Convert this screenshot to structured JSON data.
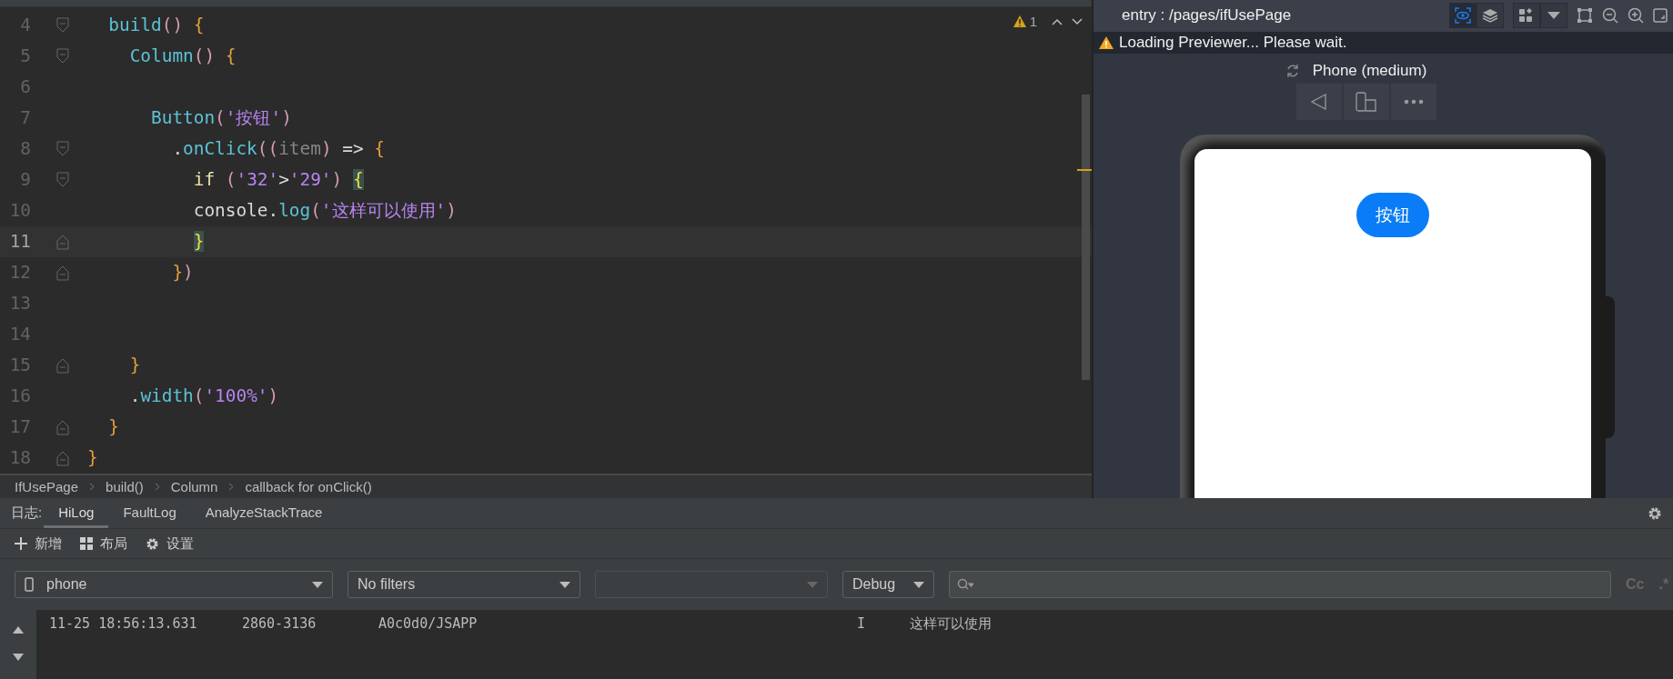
{
  "editor": {
    "warning_count": "1",
    "lines": [
      {
        "number": "4",
        "current": false,
        "block_start": true,
        "tokens": [
          {
            "kind": "fn",
            "text": "  build"
          },
          {
            "kind": "paren",
            "text": "()"
          },
          {
            "kind": "brace",
            "text": " {"
          }
        ]
      },
      {
        "number": "5",
        "current": false,
        "block_start": true,
        "tokens": [
          {
            "kind": "fn",
            "text": "    Column"
          },
          {
            "kind": "paren",
            "text": "()"
          },
          {
            "kind": "brace",
            "text": " {"
          }
        ]
      },
      {
        "number": "6",
        "current": false
      },
      {
        "number": "7",
        "current": false,
        "tokens": [
          {
            "kind": "fn",
            "text": "      Button"
          },
          {
            "kind": "paren",
            "text": "("
          },
          {
            "kind": "string",
            "text": "'按钮'"
          },
          {
            "kind": "paren",
            "text": ")"
          }
        ]
      },
      {
        "number": "8",
        "current": false,
        "block_start": true,
        "tokens": [
          {
            "kind": "plain",
            "text": "        ."
          },
          {
            "kind": "fn",
            "text": "onClick"
          },
          {
            "kind": "paren",
            "text": "(("
          },
          {
            "kind": "param",
            "text": "item"
          },
          {
            "kind": "paren",
            "text": ")"
          },
          {
            "kind": "plain",
            "text": " => "
          },
          {
            "kind": "brace",
            "text": "{"
          }
        ]
      },
      {
        "number": "9",
        "current": false,
        "block_start": true,
        "tokens": [
          {
            "kind": "kw",
            "text": "          if "
          },
          {
            "kind": "paren",
            "text": "("
          },
          {
            "kind": "string",
            "text": "'32'"
          },
          {
            "kind": "plain",
            "text": ">"
          },
          {
            "kind": "string",
            "text": "'29'"
          },
          {
            "kind": "paren",
            "text": ") "
          },
          {
            "kind": "match",
            "text": "{"
          }
        ]
      },
      {
        "number": "10",
        "current": false,
        "tokens": [
          {
            "kind": "plain",
            "text": "          console."
          },
          {
            "kind": "fn",
            "text": "log"
          },
          {
            "kind": "paren",
            "text": "("
          },
          {
            "kind": "string",
            "text": "'这样可以使用'"
          },
          {
            "kind": "paren",
            "text": ")"
          }
        ]
      },
      {
        "number": "11",
        "current": true,
        "block_end": true,
        "tokens": [
          {
            "kind": "match",
            "text": "          }"
          }
        ]
      },
      {
        "number": "12",
        "current": false,
        "block_end": true,
        "tokens": [
          {
            "kind": "brace",
            "text": "        }"
          },
          {
            "kind": "paren",
            "text": ")"
          }
        ]
      },
      {
        "number": "13",
        "current": false
      },
      {
        "number": "14",
        "current": false
      },
      {
        "number": "15",
        "current": false,
        "block_end": true,
        "tokens": [
          {
            "kind": "brace",
            "text": "    }"
          }
        ]
      },
      {
        "number": "16",
        "current": false,
        "tokens": [
          {
            "kind": "plain",
            "text": "    ."
          },
          {
            "kind": "fn",
            "text": "width"
          },
          {
            "kind": "paren",
            "text": "("
          },
          {
            "kind": "string",
            "text": "'100%'"
          },
          {
            "kind": "paren",
            "text": ")"
          }
        ]
      },
      {
        "number": "17",
        "current": false,
        "block_end": true,
        "tokens": [
          {
            "kind": "brace",
            "text": "  }"
          }
        ]
      },
      {
        "number": "18",
        "current": false,
        "block_end": true,
        "tokens": [
          {
            "kind": "brace",
            "text": "}"
          }
        ]
      }
    ]
  },
  "breadcrumbs": [
    "IfUsePage",
    "build()",
    "Column",
    "callback for onClick()"
  ],
  "preview": {
    "view_modes": [
      {
        "kind": "inspector",
        "selected": true
      },
      {
        "kind": "layers",
        "selected": false
      }
    ],
    "title": "entry : /pages/ifUsePage",
    "warning": "Loading Previewer... Please wait.",
    "device": "Phone (medium)",
    "app_button": "按钮"
  },
  "log": {
    "label": "日志:",
    "tabs": [
      {
        "label": "HiLog",
        "selected": true
      },
      {
        "label": "FaultLog",
        "selected": false
      },
      {
        "label": "AnalyzeStackTrace",
        "selected": false
      }
    ],
    "toolbar": [
      {
        "kind": "add",
        "label": "新增"
      },
      {
        "kind": "layout",
        "label": "布局"
      },
      {
        "kind": "settings",
        "label": "设置"
      }
    ],
    "device": "phone",
    "filter": "No filters",
    "level": "Debug",
    "case_toggle": "Cc",
    "regex_toggle": ".*",
    "entries": [
      {
        "time": "11-25 18:56:13.631",
        "pid": "2860-3136",
        "tag": "A0c0d0/JSAPP",
        "level": "I",
        "message": "这样可以使用"
      }
    ]
  }
}
